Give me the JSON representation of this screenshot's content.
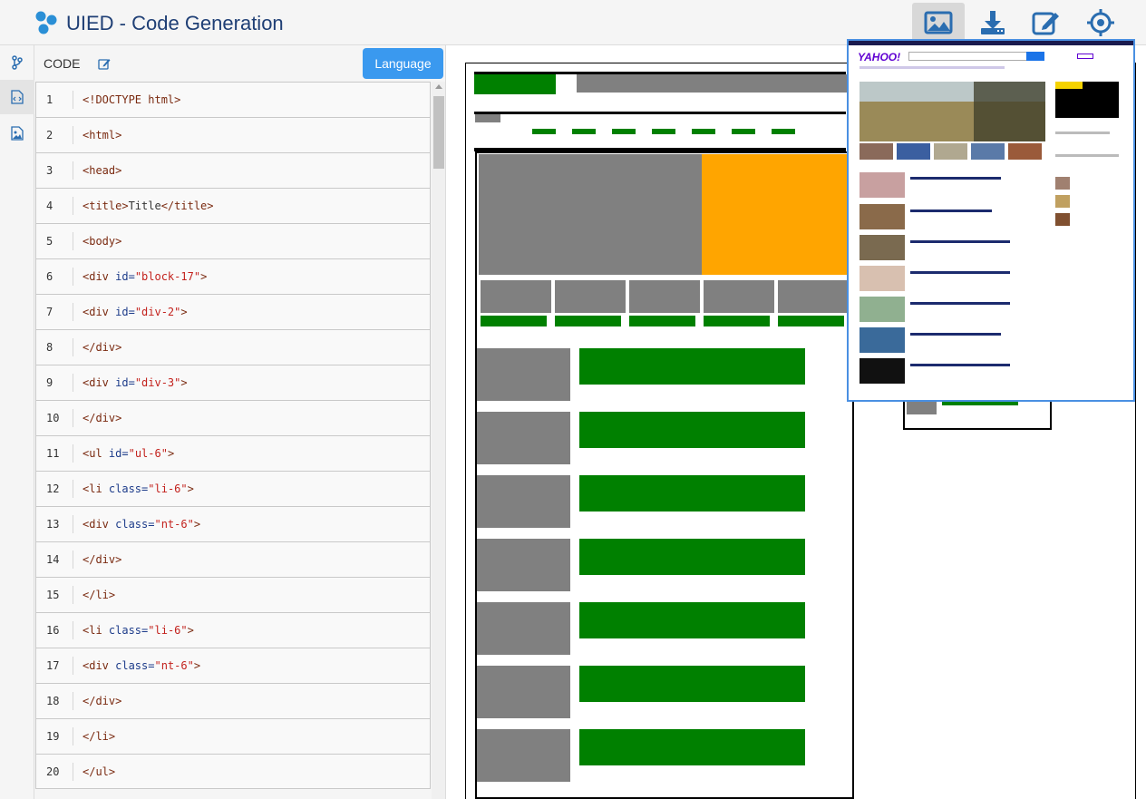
{
  "header": {
    "title": "UIED - Code Generation",
    "buttons": [
      "image-view-icon",
      "download-icon",
      "edit-icon",
      "target-icon"
    ]
  },
  "rail": {
    "items": [
      "branch-icon",
      "code-file-icon",
      "image-file-icon"
    ]
  },
  "code_panel": {
    "label": "CODE",
    "language_button": "Language",
    "lines": [
      {
        "n": "1",
        "indent": "",
        "parts": [
          [
            "tag",
            "<!DOCTYPE html>"
          ]
        ]
      },
      {
        "n": "2",
        "indent": "",
        "parts": [
          [
            "tag",
            "<html>"
          ]
        ]
      },
      {
        "n": "3",
        "indent": "",
        "parts": [
          [
            "tag",
            "<head>"
          ]
        ]
      },
      {
        "n": "4",
        "indent": "  ",
        "parts": [
          [
            "tag",
            "<title>"
          ],
          [
            "plain",
            "Title"
          ],
          [
            "tag",
            "</title>"
          ]
        ]
      },
      {
        "n": "5",
        "indent": "",
        "parts": [
          [
            "tag",
            "<body>"
          ]
        ]
      },
      {
        "n": "6",
        "indent": "",
        "parts": [
          [
            "tag",
            "<div "
          ],
          [
            "attr",
            "id="
          ],
          [
            "str",
            "\"block-17\""
          ],
          [
            "tag",
            ">"
          ]
        ]
      },
      {
        "n": "7",
        "indent": "  ",
        "parts": [
          [
            "tag",
            "<div "
          ],
          [
            "attr",
            "id="
          ],
          [
            "str",
            "\"div-2\""
          ],
          [
            "tag",
            ">"
          ]
        ]
      },
      {
        "n": "8",
        "indent": "  ",
        "parts": [
          [
            "tag",
            "</div>"
          ]
        ]
      },
      {
        "n": "9",
        "indent": "  ",
        "parts": [
          [
            "tag",
            "<div "
          ],
          [
            "attr",
            "id="
          ],
          [
            "str",
            "\"div-3\""
          ],
          [
            "tag",
            ">"
          ]
        ]
      },
      {
        "n": "10",
        "indent": "  ",
        "parts": [
          [
            "tag",
            "</div>"
          ]
        ]
      },
      {
        "n": "11",
        "indent": "  ",
        "parts": [
          [
            "tag",
            "<ul "
          ],
          [
            "attr",
            "id="
          ],
          [
            "str",
            "\"ul-6\""
          ],
          [
            "tag",
            ">"
          ]
        ]
      },
      {
        "n": "12",
        "indent": "         ",
        "parts": [
          [
            "tag",
            "<li "
          ],
          [
            "attr",
            "class="
          ],
          [
            "str",
            "\"li-6\""
          ],
          [
            "tag",
            ">"
          ]
        ]
      },
      {
        "n": "13",
        "indent": "                  ",
        "parts": [
          [
            "tag",
            "<div "
          ],
          [
            "attr",
            "class="
          ],
          [
            "str",
            "\"nt-6\""
          ],
          [
            "tag",
            ">"
          ]
        ]
      },
      {
        "n": "14",
        "indent": "                  ",
        "parts": [
          [
            "tag",
            "</div>"
          ]
        ]
      },
      {
        "n": "15",
        "indent": "         ",
        "parts": [
          [
            "tag",
            "</li>"
          ]
        ]
      },
      {
        "n": "16",
        "indent": "         ",
        "parts": [
          [
            "tag",
            "<li "
          ],
          [
            "attr",
            "class="
          ],
          [
            "str",
            "\"li-6\""
          ],
          [
            "tag",
            ">"
          ]
        ]
      },
      {
        "n": "17",
        "indent": "                  ",
        "parts": [
          [
            "tag",
            "<div "
          ],
          [
            "attr",
            "class="
          ],
          [
            "str",
            "\"nt-6\""
          ],
          [
            "tag",
            ">"
          ]
        ]
      },
      {
        "n": "18",
        "indent": "                  ",
        "parts": [
          [
            "tag",
            "</div>"
          ]
        ]
      },
      {
        "n": "19",
        "indent": "         ",
        "parts": [
          [
            "tag",
            "</li>"
          ]
        ]
      },
      {
        "n": "20",
        "indent": "  ",
        "parts": [
          [
            "tag",
            "</ul>"
          ]
        ]
      }
    ]
  },
  "overlay": {
    "brand": "YAHOO!"
  },
  "colors": {
    "accent": "#3a99ef",
    "title": "#1f3f75",
    "block_green": "#008000",
    "block_gray": "#808080",
    "block_orange": "#ffa500",
    "overlay_border": "#4a90e2"
  }
}
